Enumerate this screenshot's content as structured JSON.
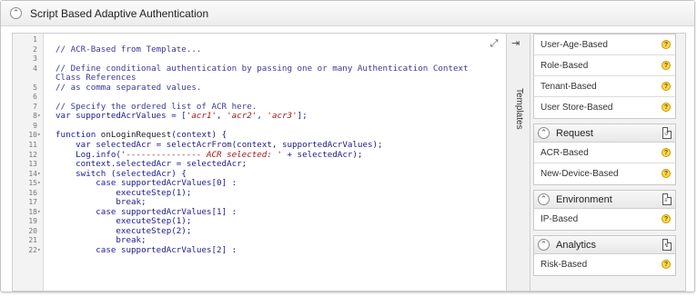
{
  "panel": {
    "title": "Script Based Adaptive Authentication",
    "collapse_icon": "chevron-up-icon"
  },
  "editor": {
    "lines": [
      {
        "n": "1",
        "fold": "",
        "parts": []
      },
      {
        "n": "2",
        "fold": "",
        "parts": [
          [
            "c-comment",
            "// ACR-Based from Template..."
          ]
        ]
      },
      {
        "n": "3",
        "fold": "",
        "parts": []
      },
      {
        "n": "4",
        "fold": "",
        "parts": [
          [
            "c-comment",
            "// Define conditional authentication by passing one or many Authentication Context"
          ]
        ]
      },
      {
        "n": "",
        "fold": "",
        "parts": [
          [
            "c-comment",
            "Class References"
          ]
        ]
      },
      {
        "n": "5",
        "fold": "",
        "parts": [
          [
            "c-comment",
            "// as comma separated values."
          ]
        ]
      },
      {
        "n": "6",
        "fold": "",
        "parts": []
      },
      {
        "n": "7",
        "fold": "",
        "parts": [
          [
            "c-comment",
            "// Specify the ordered list of ACR here."
          ]
        ]
      },
      {
        "n": "8",
        "fold": "▾",
        "parts": [
          [
            "c-kw",
            "var "
          ],
          [
            "c-plain",
            "supportedAcrValues = ["
          ],
          [
            "c-str",
            "'acr1'"
          ],
          [
            "c-plain",
            ", "
          ],
          [
            "c-str",
            "'acr2'"
          ],
          [
            "c-plain",
            ", "
          ],
          [
            "c-str",
            "'acr3'"
          ],
          [
            "c-plain",
            "];"
          ]
        ]
      },
      {
        "n": "9",
        "fold": "",
        "parts": []
      },
      {
        "n": "10",
        "fold": "▾",
        "parts": [
          [
            "c-kw",
            "function "
          ],
          [
            "c-fn",
            "onLoginRequest"
          ],
          [
            "c-plain",
            "(context) {"
          ]
        ]
      },
      {
        "n": "11",
        "fold": "",
        "parts": [
          [
            "c-plain",
            "    "
          ],
          [
            "c-kw",
            "var "
          ],
          [
            "c-plain",
            "selectedAcr = selectAcrFrom(context, supportedAcrValues);"
          ]
        ]
      },
      {
        "n": "12",
        "fold": "",
        "parts": [
          [
            "c-plain",
            "    Log.info("
          ],
          [
            "c-str",
            "'--------------- ACR selected: '"
          ],
          [
            "c-plain",
            " + selectedAcr);"
          ]
        ]
      },
      {
        "n": "13",
        "fold": "",
        "parts": [
          [
            "c-plain",
            "    context.selectedAcr = selectedAcr;"
          ]
        ]
      },
      {
        "n": "14",
        "fold": "▾",
        "parts": [
          [
            "c-plain",
            "    "
          ],
          [
            "c-kw",
            "switch "
          ],
          [
            "c-plain",
            "(selectedAcr) {"
          ]
        ]
      },
      {
        "n": "15",
        "fold": "▾",
        "parts": [
          [
            "c-plain",
            "        "
          ],
          [
            "c-kw",
            "case "
          ],
          [
            "c-plain",
            "supportedAcrValues[0] :"
          ]
        ]
      },
      {
        "n": "16",
        "fold": "",
        "parts": [
          [
            "c-plain",
            "            executeStep(1);"
          ]
        ]
      },
      {
        "n": "17",
        "fold": "",
        "parts": [
          [
            "c-plain",
            "            break;"
          ]
        ]
      },
      {
        "n": "18",
        "fold": "▾",
        "parts": [
          [
            "c-plain",
            "        "
          ],
          [
            "c-kw",
            "case "
          ],
          [
            "c-plain",
            "supportedAcrValues[1] :"
          ]
        ]
      },
      {
        "n": "19",
        "fold": "",
        "parts": [
          [
            "c-plain",
            "            executeStep(1);"
          ]
        ]
      },
      {
        "n": "20",
        "fold": "",
        "parts": [
          [
            "c-plain",
            "            executeStep(2);"
          ]
        ]
      },
      {
        "n": "21",
        "fold": "",
        "parts": [
          [
            "c-plain",
            "            break;"
          ]
        ]
      },
      {
        "n": "22",
        "fold": "▾",
        "parts": [
          [
            "c-plain",
            "        "
          ],
          [
            "c-kw",
            "case "
          ],
          [
            "c-plain",
            "supportedAcrValues[2] :"
          ]
        ]
      }
    ]
  },
  "templates_tab": {
    "label": "Templates",
    "icon": "collapse-right-icon"
  },
  "expand_icon": "expand-icon",
  "sidebar": {
    "top_items": [
      {
        "label": "User-Age-Based"
      },
      {
        "label": "Role-Based"
      },
      {
        "label": "Tenant-Based"
      },
      {
        "label": "User Store-Based"
      }
    ],
    "groups": [
      {
        "title": "Request",
        "items": [
          {
            "label": "ACR-Based"
          },
          {
            "label": "New-Device-Based"
          }
        ]
      },
      {
        "title": "Environment",
        "items": [
          {
            "label": "IP-Based"
          }
        ]
      },
      {
        "title": "Analytics",
        "items": [
          {
            "label": "Risk-Based"
          }
        ]
      }
    ],
    "help_glyph": "?"
  }
}
